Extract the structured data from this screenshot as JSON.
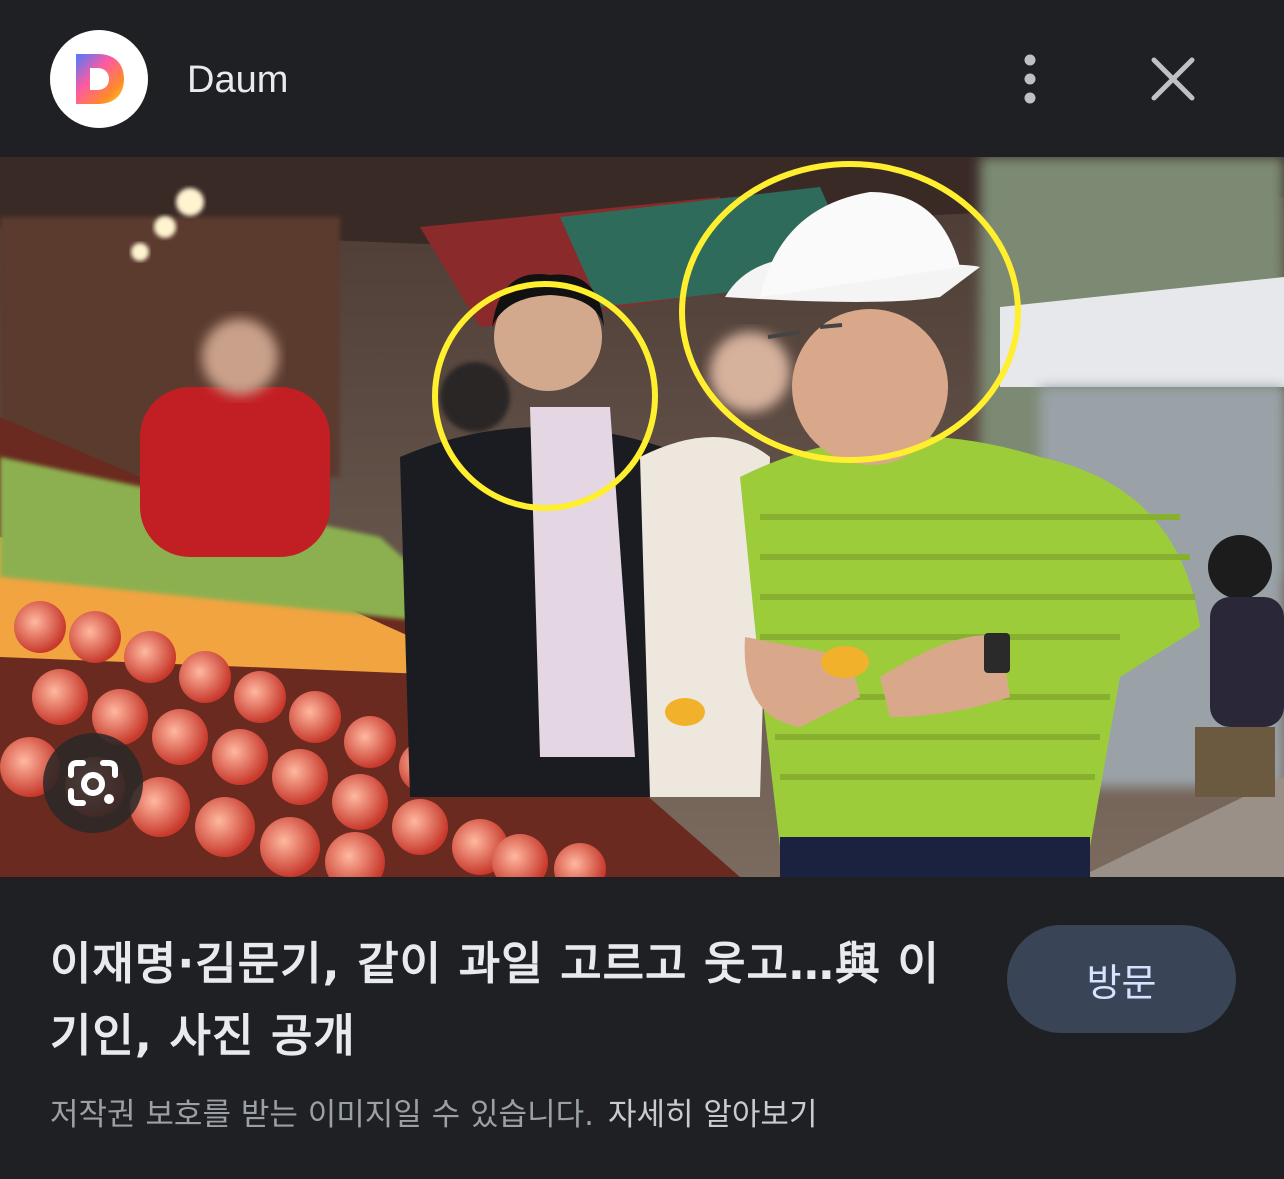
{
  "header": {
    "site_name": "Daum",
    "logo_icon": "daum-d-logo-icon",
    "more_icon": "more-vert-icon",
    "close_icon": "close-icon"
  },
  "image": {
    "lens_icon": "google-lens-icon",
    "highlight_color": "#ffef2f"
  },
  "result": {
    "headline": "이재명·김문기, 같이 과일 고르고 웃고…與 이기인, 사진 공개",
    "visit_label": "방문",
    "copyright_notice": "저작권 보호를 받는 이미지일 수 있습니다.",
    "learn_more": "자세히 알아보기"
  },
  "colors": {
    "background": "#1f2023",
    "button_bg": "#394457",
    "button_text": "#d6e2ff",
    "secondary_text": "#9aa0a6"
  }
}
